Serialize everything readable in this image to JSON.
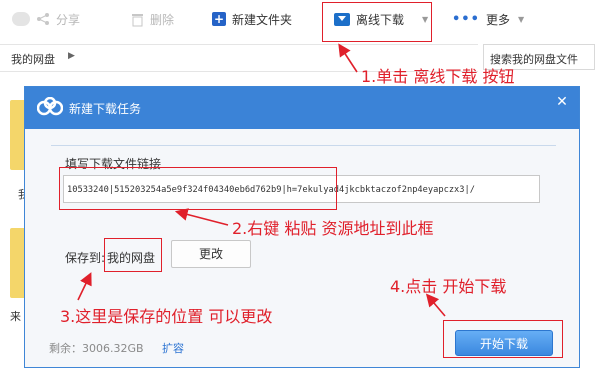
{
  "toolbar": {
    "share_label": "分享",
    "delete_label": "删除",
    "new_folder_label": "新建文件夹",
    "offline_label": "离线下载",
    "more_label": "更多"
  },
  "pathbar": {
    "root": "我的网盘",
    "search_placeholder": "搜索我的网盘文件"
  },
  "background": {
    "item1": "我",
    "item2": "来"
  },
  "dialog": {
    "title": "新建下载任务",
    "link_label": "填写下载文件链接",
    "link_value": "10533240|515203254a5e9f324f04340eb6d762b9|h=7ekulyad4jkcbktaczof2np4eyapczx3|/",
    "save_label": "保存到:",
    "save_value": "我的网盘",
    "change_button": "更改",
    "space_label": "剩余：3006.32GB",
    "expand_link": "扩容",
    "start_button": "开始下载"
  },
  "annotations": {
    "step1": "1.单击 离线下载 按钮",
    "step2": "2.右键 粘贴 资源地址到此框",
    "step3": "3.这里是保存的位置 可以更改",
    "step4": "4.点击 开始下载"
  },
  "colors": {
    "accent": "#3b83d7",
    "annotation": "#e0202b"
  }
}
